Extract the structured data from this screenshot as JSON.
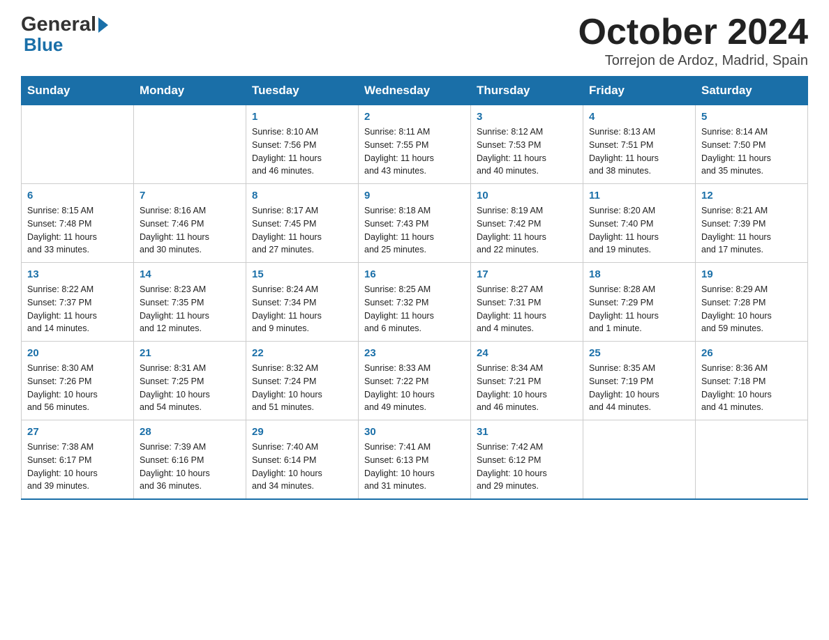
{
  "header": {
    "month_title": "October 2024",
    "location": "Torrejon de Ardoz, Madrid, Spain"
  },
  "days_of_week": [
    "Sunday",
    "Monday",
    "Tuesday",
    "Wednesday",
    "Thursday",
    "Friday",
    "Saturday"
  ],
  "weeks": [
    [
      {
        "day": "",
        "info": ""
      },
      {
        "day": "",
        "info": ""
      },
      {
        "day": "1",
        "info": "Sunrise: 8:10 AM\nSunset: 7:56 PM\nDaylight: 11 hours\nand 46 minutes."
      },
      {
        "day": "2",
        "info": "Sunrise: 8:11 AM\nSunset: 7:55 PM\nDaylight: 11 hours\nand 43 minutes."
      },
      {
        "day": "3",
        "info": "Sunrise: 8:12 AM\nSunset: 7:53 PM\nDaylight: 11 hours\nand 40 minutes."
      },
      {
        "day": "4",
        "info": "Sunrise: 8:13 AM\nSunset: 7:51 PM\nDaylight: 11 hours\nand 38 minutes."
      },
      {
        "day": "5",
        "info": "Sunrise: 8:14 AM\nSunset: 7:50 PM\nDaylight: 11 hours\nand 35 minutes."
      }
    ],
    [
      {
        "day": "6",
        "info": "Sunrise: 8:15 AM\nSunset: 7:48 PM\nDaylight: 11 hours\nand 33 minutes."
      },
      {
        "day": "7",
        "info": "Sunrise: 8:16 AM\nSunset: 7:46 PM\nDaylight: 11 hours\nand 30 minutes."
      },
      {
        "day": "8",
        "info": "Sunrise: 8:17 AM\nSunset: 7:45 PM\nDaylight: 11 hours\nand 27 minutes."
      },
      {
        "day": "9",
        "info": "Sunrise: 8:18 AM\nSunset: 7:43 PM\nDaylight: 11 hours\nand 25 minutes."
      },
      {
        "day": "10",
        "info": "Sunrise: 8:19 AM\nSunset: 7:42 PM\nDaylight: 11 hours\nand 22 minutes."
      },
      {
        "day": "11",
        "info": "Sunrise: 8:20 AM\nSunset: 7:40 PM\nDaylight: 11 hours\nand 19 minutes."
      },
      {
        "day": "12",
        "info": "Sunrise: 8:21 AM\nSunset: 7:39 PM\nDaylight: 11 hours\nand 17 minutes."
      }
    ],
    [
      {
        "day": "13",
        "info": "Sunrise: 8:22 AM\nSunset: 7:37 PM\nDaylight: 11 hours\nand 14 minutes."
      },
      {
        "day": "14",
        "info": "Sunrise: 8:23 AM\nSunset: 7:35 PM\nDaylight: 11 hours\nand 12 minutes."
      },
      {
        "day": "15",
        "info": "Sunrise: 8:24 AM\nSunset: 7:34 PM\nDaylight: 11 hours\nand 9 minutes."
      },
      {
        "day": "16",
        "info": "Sunrise: 8:25 AM\nSunset: 7:32 PM\nDaylight: 11 hours\nand 6 minutes."
      },
      {
        "day": "17",
        "info": "Sunrise: 8:27 AM\nSunset: 7:31 PM\nDaylight: 11 hours\nand 4 minutes."
      },
      {
        "day": "18",
        "info": "Sunrise: 8:28 AM\nSunset: 7:29 PM\nDaylight: 11 hours\nand 1 minute."
      },
      {
        "day": "19",
        "info": "Sunrise: 8:29 AM\nSunset: 7:28 PM\nDaylight: 10 hours\nand 59 minutes."
      }
    ],
    [
      {
        "day": "20",
        "info": "Sunrise: 8:30 AM\nSunset: 7:26 PM\nDaylight: 10 hours\nand 56 minutes."
      },
      {
        "day": "21",
        "info": "Sunrise: 8:31 AM\nSunset: 7:25 PM\nDaylight: 10 hours\nand 54 minutes."
      },
      {
        "day": "22",
        "info": "Sunrise: 8:32 AM\nSunset: 7:24 PM\nDaylight: 10 hours\nand 51 minutes."
      },
      {
        "day": "23",
        "info": "Sunrise: 8:33 AM\nSunset: 7:22 PM\nDaylight: 10 hours\nand 49 minutes."
      },
      {
        "day": "24",
        "info": "Sunrise: 8:34 AM\nSunset: 7:21 PM\nDaylight: 10 hours\nand 46 minutes."
      },
      {
        "day": "25",
        "info": "Sunrise: 8:35 AM\nSunset: 7:19 PM\nDaylight: 10 hours\nand 44 minutes."
      },
      {
        "day": "26",
        "info": "Sunrise: 8:36 AM\nSunset: 7:18 PM\nDaylight: 10 hours\nand 41 minutes."
      }
    ],
    [
      {
        "day": "27",
        "info": "Sunrise: 7:38 AM\nSunset: 6:17 PM\nDaylight: 10 hours\nand 39 minutes."
      },
      {
        "day": "28",
        "info": "Sunrise: 7:39 AM\nSunset: 6:16 PM\nDaylight: 10 hours\nand 36 minutes."
      },
      {
        "day": "29",
        "info": "Sunrise: 7:40 AM\nSunset: 6:14 PM\nDaylight: 10 hours\nand 34 minutes."
      },
      {
        "day": "30",
        "info": "Sunrise: 7:41 AM\nSunset: 6:13 PM\nDaylight: 10 hours\nand 31 minutes."
      },
      {
        "day": "31",
        "info": "Sunrise: 7:42 AM\nSunset: 6:12 PM\nDaylight: 10 hours\nand 29 minutes."
      },
      {
        "day": "",
        "info": ""
      },
      {
        "day": "",
        "info": ""
      }
    ]
  ]
}
